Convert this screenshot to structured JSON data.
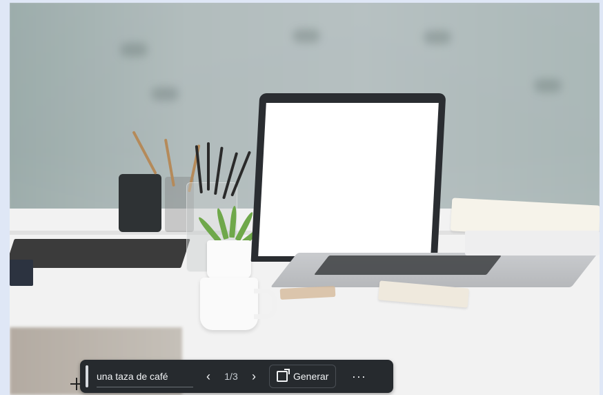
{
  "search_bar": {
    "query_text": "una taza de café",
    "counter": "1/3",
    "generate_label": "Generar",
    "prev_icon": "chevron-left-icon",
    "next_icon": "chevron-right-icon",
    "generate_icon": "open-external-icon",
    "more_icon": "more-horizontal-icon"
  },
  "colors": {
    "toolbar_bg": "#262a2e",
    "toolbar_text": "#e9ecef"
  }
}
